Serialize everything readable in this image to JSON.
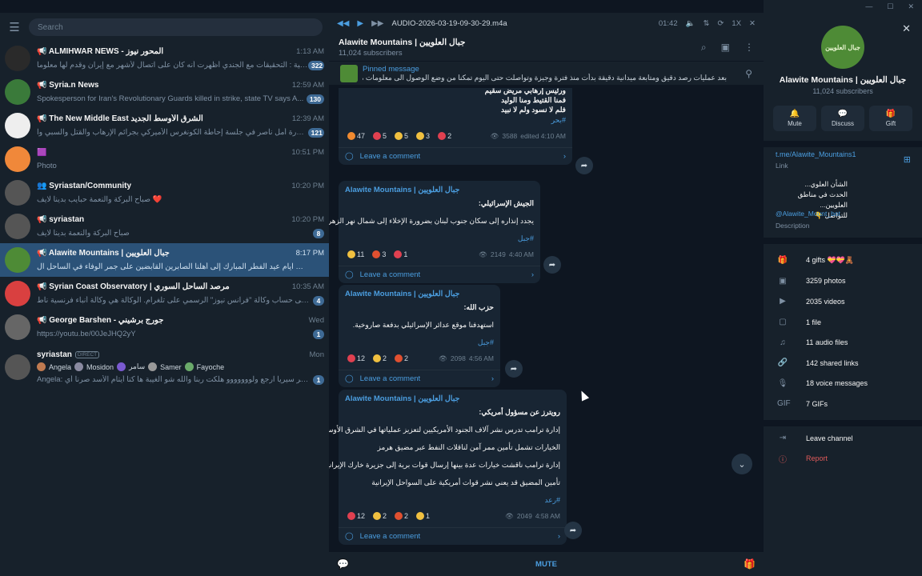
{
  "search_placeholder": "Search",
  "chats": [
    {
      "title": "📢 ALMIHWAR NEWS - المحور نيوز",
      "time": "1:13 AM",
      "preview": "الشرطة الصهيونية : التحقيقات مع الجندي أظهرت أنه كان على اتصال لأشهر مع إيران وقدم لها معلوما...",
      "badge": "322",
      "avatar_color": "#2a2a2a"
    },
    {
      "title": "📢 Syria.n News",
      "time": "12:59 AM",
      "preview": "Spokesperson for Iran's Revolutionary Guards killed in strike, state TV says  A...",
      "badge": "130",
      "avatar_color": "#3a7a3a"
    },
    {
      "title": "📢 The New Middle East الشرق الأوسط الجديد",
      "time": "12:39 AM",
      "preview": "مشاركة الدكتورة أمل ناصر في جلسة إحاطة الكونغرس الأميركي  بجرائم الإرهاب والقتل والسبي وا...",
      "badge": "121",
      "avatar_color": "#eeeeee"
    },
    {
      "title": "🟪",
      "time": "10:51 PM",
      "preview": "Photo",
      "badge": "",
      "avatar_color": "#f0883a"
    },
    {
      "title": "👥 Syriastan/Community",
      "time": "10:20 PM",
      "preview": "صباح البركة والنعمة حبايب بدينا لايف ❤️",
      "badge": "",
      "avatar_color": "#555555"
    },
    {
      "title": "📢 syriastan",
      "time": "10:20 PM",
      "preview": "صباح البركة والنعمة بدينا لايف",
      "badge": "8",
      "avatar_color": "#555555"
    },
    {
      "title": "📢 Alawite Mountains | جبال العلويين",
      "time": "8:17 PM",
      "preview": "في ثالث ايام عيد الفطر المبارك إلى أهلنا الصابرين القابضين على جمر الوفاء في الساحل ال...",
      "badge": "",
      "avatar_color": "#4e8b36"
    },
    {
      "title": "📢 Syrian Coast Observatory | مرصد الساحل السوري",
      "time": "10:35 AM",
      "preview": "ندعوكم للانضمام إلى حساب وكالة \"فرانس نيوز\" الرسمي على تلغرام. الوكالة هي وكالة أنباء فرنسية ناط...",
      "badge": "4",
      "avatar_color": "#d94040"
    },
    {
      "title": "📢 George Barshen - جورج برشيني",
      "time": "Wed",
      "preview": "https://youtu.be/00JeJHQ2yY",
      "badge": "1",
      "avatar_color": "#666666"
    },
    {
      "title": "syriastan",
      "time": "Mon",
      "preview": "Angela: اشتقنا لك كتير سيريا ارجع ولووووووو هلكت ربنا والله شو الغيبة ها كنا أيتام الأسد صرنا أي...",
      "badge": "1",
      "avatar_color": "#555555"
    }
  ],
  "direct_tag": "DIRECT",
  "members": [
    "Angela",
    "Mosidon",
    "سامر",
    "Samer",
    "Fayoche"
  ],
  "player": {
    "track": "AUDIO-2026-03-19-09-30-29.m4a",
    "time": "01:42",
    "speed": "1X"
  },
  "header": {
    "title": "Alawite Mountains | جبال العلويين",
    "subscribers": "11,024 subscribers"
  },
  "pinned": {
    "label": "Pinned message",
    "text": "بعد عمليات رصد دقيق ومتابعة ميدانية دقيقة بدأت منذ فترة وجيزة وتواصلت حتى اليوم تمكنا من وضع الوصول الى معلومات مؤكدة ..."
  },
  "messages": [
    {
      "author": "",
      "lines": [
        "ورئيس إرهابي مريض سقيم",
        "فمنا القتيط ومنا الوليد",
        "فلم لا نسود ولم لا نبيد"
      ],
      "tag": "#بحر",
      "reactions": [
        [
          "🔥",
          "47"
        ],
        [
          "❤",
          "5"
        ],
        [
          "👏",
          "5"
        ],
        [
          "👍",
          "3"
        ],
        [
          "💯",
          "2"
        ]
      ],
      "views": "3588",
      "time": "edited 4:10 AM",
      "comment": "Leave a comment"
    },
    {
      "author": "Alawite Mountains | جبال العلويين",
      "lines": [
        "الجيش الإسرائيلي:",
        "يجدد إنذاره إلى سكان جنوب لبنان بضرورة الإخلاء إلى شمال نهر الزهراني."
      ],
      "tag": "#جبل",
      "reactions": [
        [
          "😱",
          "11"
        ],
        [
          "😡",
          "3"
        ],
        [
          "❤",
          "1"
        ]
      ],
      "views": "2149",
      "time": "4:40 AM",
      "comment": "Leave a comment"
    },
    {
      "author": "Alawite Mountains | جبال العلويين",
      "lines": [
        "حزب الله:",
        "استهدفنا موقع عدائر الإسرائيلي بدفعة صاروخية."
      ],
      "tag": "#جبل",
      "reactions": [
        [
          "❤",
          "12"
        ],
        [
          "😱",
          "2"
        ],
        [
          "😡",
          "2"
        ]
      ],
      "views": "2098",
      "time": "4:56 AM",
      "comment": "Leave a comment"
    },
    {
      "author": "Alawite Mountains | جبال العلويين",
      "lines": [
        "رويترز عن مسؤول أمريكي:",
        "إدارة ترامب تدرس نشر آلاف الجنود الأمريكيين لتعزيز عملياتها في الشرق الأوسط",
        "الخيارات تشمل تأمين ممر آمن لناقلات النفط عبر مضيق هرمز",
        "إدارة ترامب ناقشت خيارات عدة بينها إرسال قوات برية إلى جزيرة خارك الإيرانية",
        "تأمين المضيق قد يعني نشر قوات أمريكية على السواحل الإيرانية"
      ],
      "tag": "#رعد",
      "reactions": [
        [
          "❤",
          "12"
        ],
        [
          "👍",
          "2"
        ],
        [
          "😡",
          "2"
        ],
        [
          "👍",
          "1"
        ]
      ],
      "views": "2049",
      "time": "4:58 AM",
      "comment": "Leave a comment"
    }
  ],
  "bottom": {
    "mute": "MUTE"
  },
  "profile": {
    "name": "Alawite Mountains | جبال العلويين",
    "subs": "11,024 subscribers",
    "avatar_text": "جبال العلويين",
    "actions": [
      "Mute",
      "Discuss",
      "Gift"
    ],
    "link": "t.me/Alawite_Mountains1",
    "link_label": "Link",
    "desc_lines": [
      "الشأن العلوي...",
      "الحدث في مناطق العلويين...",
      "للتواصل 👇"
    ],
    "desc_handle": "@Alawite_Mount_bot",
    "desc_label": "Description",
    "stats": [
      "4 gifts 💝💝🧸",
      "3259 photos",
      "2035 videos",
      "1 file",
      "11 audio files",
      "142 shared links",
      "18 voice messages",
      "7 GIFs"
    ],
    "leave": "Leave channel",
    "report": "Report"
  },
  "colors": {
    "accent": "#4b9ee0",
    "active": "#2b5278",
    "danger": "#e05a5a"
  }
}
